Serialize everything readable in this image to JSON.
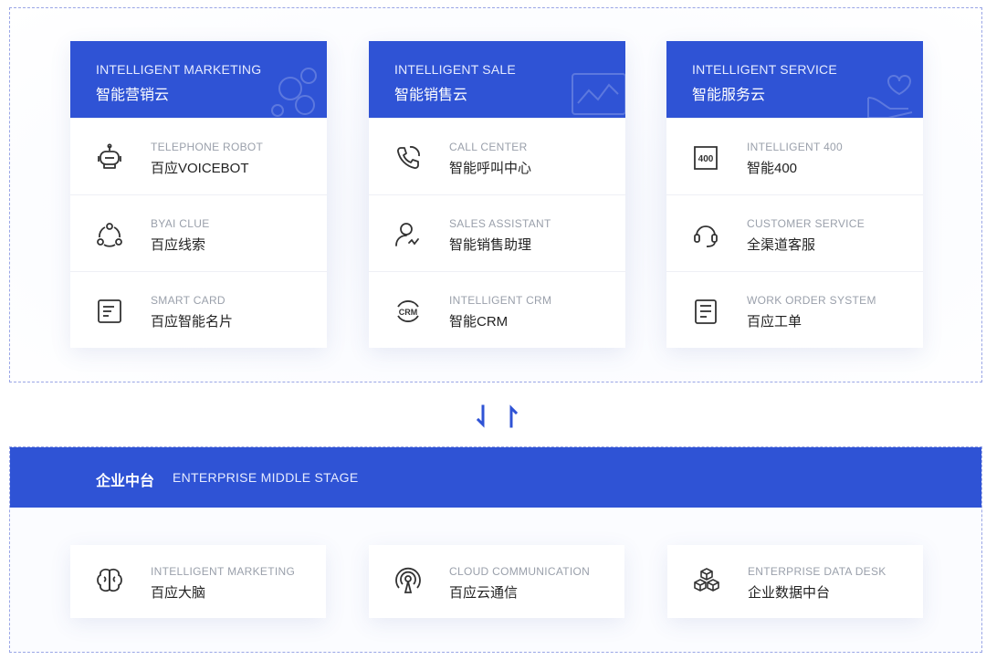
{
  "colors": {
    "primary": "#2f53d5",
    "text": "#222222",
    "muted": "#9aa0ab"
  },
  "columns": [
    {
      "title_en": "INTELLIGENT MARKETING",
      "title_cn": "智能营销云",
      "items": [
        {
          "en": "TELEPHONE ROBOT",
          "cn": "百应VOICEBOT",
          "icon": "robot-icon"
        },
        {
          "en": "BYAI CLUE",
          "cn": "百应线索",
          "icon": "clue-icon"
        },
        {
          "en": "SMART CARD",
          "cn": "百应智能名片",
          "icon": "card-icon"
        }
      ]
    },
    {
      "title_en": "INTELLIGENT SALE",
      "title_cn": "智能销售云",
      "items": [
        {
          "en": "CALL CENTER",
          "cn": "智能呼叫中心",
          "icon": "phone-icon"
        },
        {
          "en": "SALES ASSISTANT",
          "cn": "智能销售助理",
          "icon": "assistant-icon"
        },
        {
          "en": "INTELLIGENT CRM",
          "cn": "智能CRM",
          "icon": "crm-icon",
          "icon_text": "CRM"
        }
      ]
    },
    {
      "title_en": "INTELLIGENT SERVICE",
      "title_cn": "智能服务云",
      "items": [
        {
          "en": "INTELLIGENT 400",
          "cn": "智能400",
          "icon": "400-icon",
          "icon_text": "400"
        },
        {
          "en": "CUSTOMER SERVICE",
          "cn": "全渠道客服",
          "icon": "headset-icon"
        },
        {
          "en": "WORK ORDER SYSTEM",
          "cn": "百应工单",
          "icon": "work-order-icon"
        }
      ]
    }
  ],
  "middle": {
    "title_cn": "企业中台",
    "title_en": "ENTERPRISE MIDDLE STAGE",
    "items": [
      {
        "en": "INTELLIGENT MARKETING",
        "cn": "百应大脑",
        "icon": "brain-icon"
      },
      {
        "en": "CLOUD COMMUNICATION",
        "cn": "百应云通信",
        "icon": "signal-icon"
      },
      {
        "en": "ENTERPRISE DATA DESK",
        "cn": "企业数据中台",
        "icon": "cubes-icon"
      }
    ]
  }
}
